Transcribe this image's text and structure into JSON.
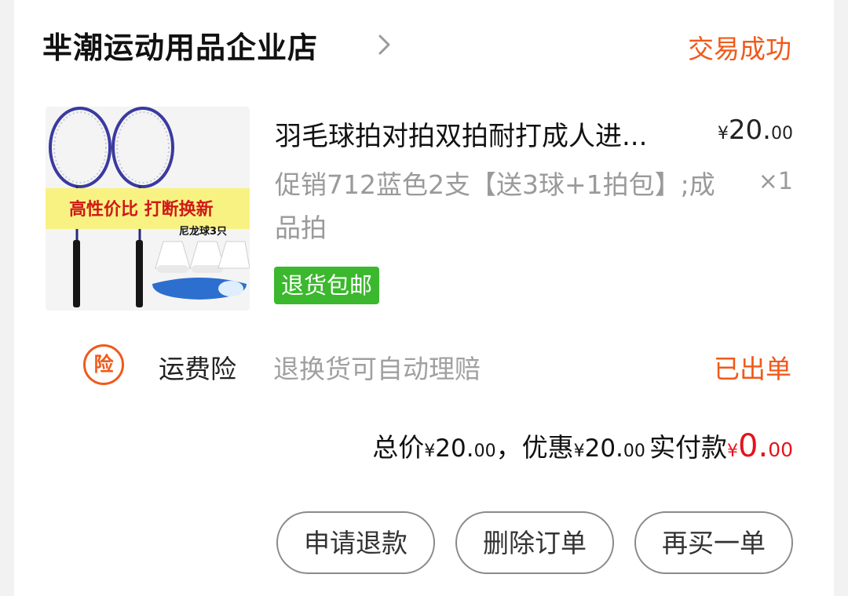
{
  "shop": {
    "name": "芈潮运动用品企业店",
    "chevron_icon": "chevron-right-icon"
  },
  "order": {
    "status": "交易成功"
  },
  "product": {
    "image_icon": "badminton-racket-product-image",
    "image_banner_text": "高性价比 打断换新",
    "image_sub_text": "尼龙球3只",
    "title": "羽毛球拍对拍双拍耐打成人进...",
    "price_currency": "¥",
    "price_integer": "20.",
    "price_decimal": "00",
    "spec": "促销712蓝色2支【送3球+1拍包】;成品拍",
    "quantity": "×1",
    "badge": "退货包邮"
  },
  "insurance": {
    "icon_text": "险",
    "label": "运费险",
    "description": "退换货可自动理赔",
    "status": "已出单"
  },
  "totals": {
    "total_label": "总价",
    "total_currency": "¥",
    "total_integer": "20.",
    "total_decimal": "00",
    "separator": "，",
    "discount_label": "优惠",
    "discount_currency": "¥",
    "discount_integer": "20.",
    "discount_decimal": "00",
    "paid_label": "实付款",
    "paid_currency": "¥",
    "paid_integer": "0.",
    "paid_decimal": "00"
  },
  "actions": {
    "refund": "申请退款",
    "delete": "删除订单",
    "rebuy": "再买一单"
  },
  "colors": {
    "accent_orange": "#f05a1a",
    "price_red": "#e5131b",
    "badge_green": "#3bb82d"
  }
}
